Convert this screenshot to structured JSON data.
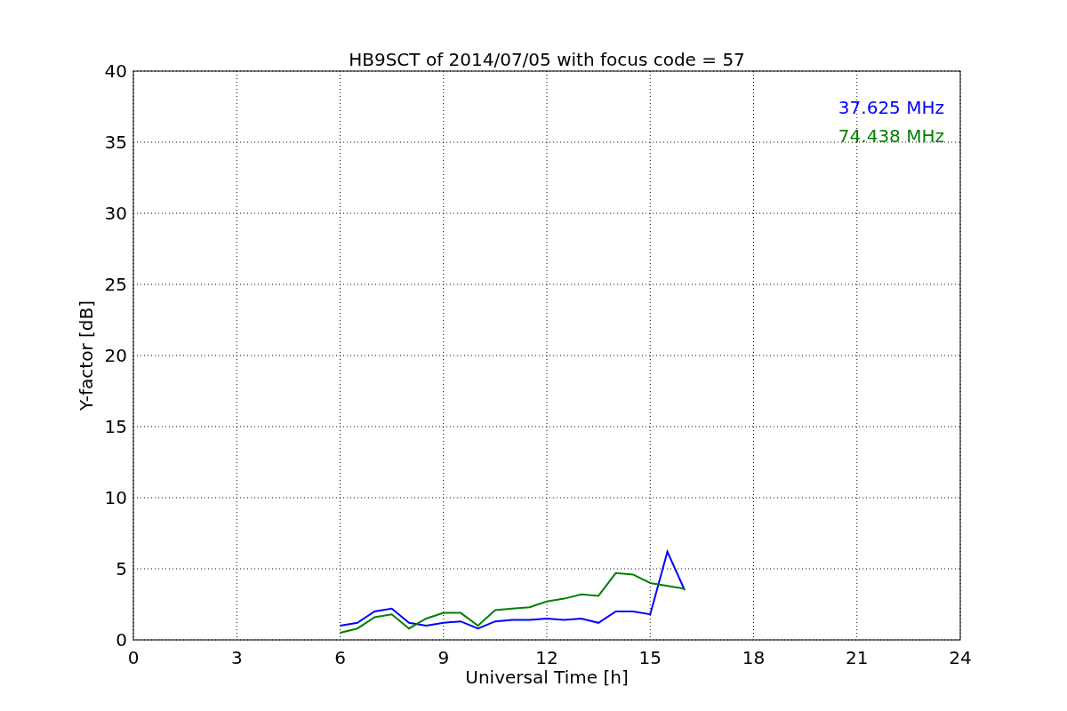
{
  "chart_data": {
    "type": "line",
    "title": "HB9SCT of 2014/07/05 with focus code = 57",
    "xlabel": "Universal Time [h]",
    "ylabel": "Y-factor [dB]",
    "x": [
      6,
      6.5,
      7,
      7.5,
      8,
      8.5,
      9,
      9.5,
      10,
      10.5,
      11,
      11.5,
      12,
      12.5,
      13,
      13.5,
      14,
      14.5,
      15,
      15.5,
      16
    ],
    "series": [
      {
        "name": "37.625 MHz",
        "color": "#0000ff",
        "values": [
          1.0,
          1.2,
          2.0,
          2.2,
          1.2,
          1.0,
          1.2,
          1.3,
          0.8,
          1.3,
          1.4,
          1.4,
          1.5,
          1.4,
          1.5,
          1.2,
          2.0,
          2.0,
          1.8,
          6.2,
          3.5
        ]
      },
      {
        "name": "74.438 MHz",
        "color": "#008000",
        "values": [
          0.5,
          0.8,
          1.6,
          1.8,
          0.8,
          1.5,
          1.9,
          1.9,
          1.0,
          2.1,
          2.2,
          2.3,
          2.7,
          2.9,
          3.2,
          3.1,
          4.7,
          4.6,
          4.0,
          3.8,
          3.6
        ]
      }
    ],
    "grid": true,
    "xlim": [
      0,
      24
    ],
    "ylim": [
      0,
      40
    ],
    "xticks": [
      0,
      3,
      6,
      9,
      12,
      15,
      18,
      21,
      24
    ],
    "yticks": [
      0,
      5,
      10,
      15,
      20,
      25,
      30,
      35,
      40
    ]
  }
}
